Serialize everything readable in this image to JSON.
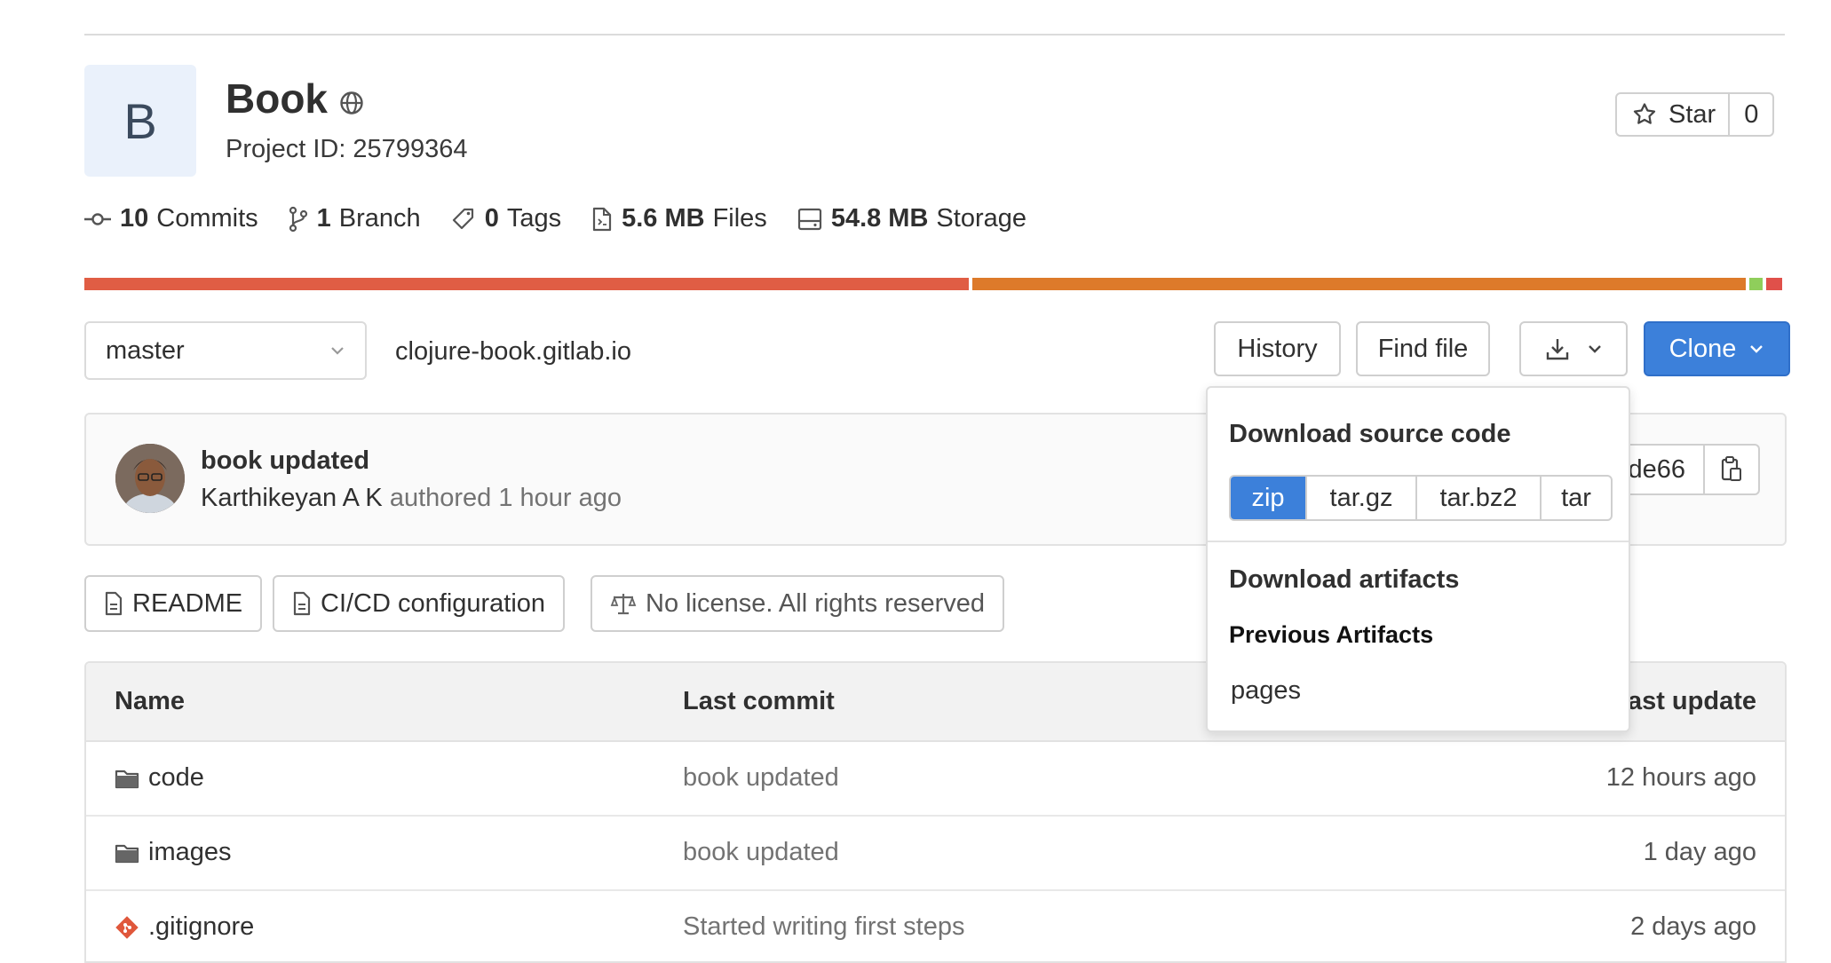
{
  "project": {
    "avatar_letter": "B",
    "title": "Book",
    "project_id": "Project ID: 25799364",
    "star_label": "Star",
    "star_count": "0"
  },
  "stats": [
    {
      "icon": "commit-icon",
      "value": "10",
      "label": "Commits"
    },
    {
      "icon": "branch-icon",
      "value": "1",
      "label": "Branch"
    },
    {
      "icon": "tag-icon",
      "value": "0",
      "label": "Tags"
    },
    {
      "icon": "file-icon",
      "value": "5.6 MB",
      "label": "Files"
    },
    {
      "icon": "storage-icon",
      "value": "54.8 MB",
      "label": "Storage"
    }
  ],
  "language_bar": {
    "colors": [
      "#e05d44",
      "#dd7a2a",
      "#8fce5b",
      "#e0504a"
    ],
    "fractions": [
      0.52,
      0.455,
      0.008,
      0.009
    ]
  },
  "toolbar": {
    "branch": "master",
    "repo_path": "clojure-book.gitlab.io",
    "history": "History",
    "find_file": "Find file",
    "clone": "Clone"
  },
  "commit": {
    "message": "book updated",
    "author": "Karthikeyan A K",
    "authored": "authored 1 hour ago",
    "sha_partial": "de66"
  },
  "badges": {
    "readme": "README",
    "cicd": "CI/CD configuration",
    "license": "No license. All rights reserved"
  },
  "table": {
    "headers": {
      "name": "Name",
      "last_commit": "Last commit",
      "last_update": "Last update"
    },
    "rows": [
      {
        "icon": "folder-icon",
        "name": "code",
        "commit": "book updated",
        "date": "12 hours ago"
      },
      {
        "icon": "folder-icon",
        "name": "images",
        "commit": "book updated",
        "date": "1 day ago"
      },
      {
        "icon": "git-icon",
        "name": ".gitignore",
        "commit": "Started writing first steps",
        "date": "2 days ago"
      }
    ]
  },
  "dropdown": {
    "source_heading": "Download source code",
    "formats": [
      "zip",
      "tar.gz",
      "tar.bz2",
      "tar"
    ],
    "selected": "zip",
    "artifacts_heading": "Download artifacts",
    "previous_artifacts": "Previous Artifacts",
    "artifact_item": "pages"
  },
  "colors": {
    "accent": "#3c80da",
    "text": "#303030",
    "muted": "#737373"
  }
}
